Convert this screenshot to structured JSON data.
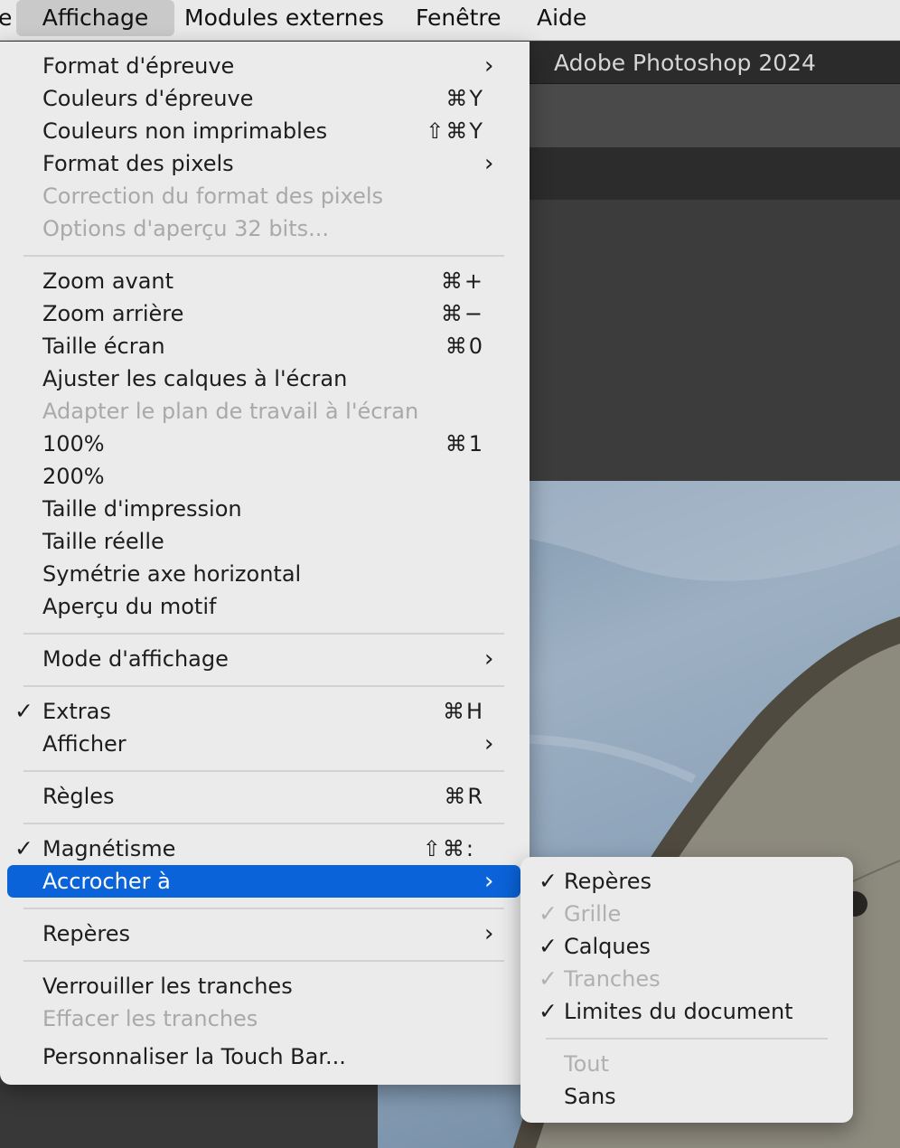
{
  "menubar": {
    "items": [
      {
        "label": "e"
      },
      {
        "label": "Affichage"
      },
      {
        "label": "Modules externes"
      },
      {
        "label": "Fenêtre"
      },
      {
        "label": "Aide"
      }
    ]
  },
  "window": {
    "title": "Adobe Photoshop 2024"
  },
  "menu": {
    "items": [
      {
        "label": "Format d'épreuve",
        "submenu_arrow": "›"
      },
      {
        "label": "Couleurs d'épreuve",
        "shortcut": "⌘Y"
      },
      {
        "label": "Couleurs non imprimables",
        "shortcut": "⇧⌘Y"
      },
      {
        "label": "Format des pixels",
        "submenu_arrow": "›"
      },
      {
        "label": "Correction du format des pixels",
        "disabled": true
      },
      {
        "label": "Options d'aperçu 32 bits...",
        "disabled": true
      },
      {
        "label": "Zoom avant",
        "shortcut": "⌘+"
      },
      {
        "label": "Zoom arrière",
        "shortcut": "⌘−"
      },
      {
        "label": "Taille écran",
        "shortcut": "⌘0"
      },
      {
        "label": "Ajuster les calques à l'écran"
      },
      {
        "label": "Adapter le plan de travail à l'écran",
        "disabled": true
      },
      {
        "label": "100%",
        "shortcut": "⌘1"
      },
      {
        "label": "200%"
      },
      {
        "label": "Taille d'impression"
      },
      {
        "label": "Taille réelle"
      },
      {
        "label": "Symétrie axe horizontal"
      },
      {
        "label": "Aperçu du motif"
      },
      {
        "label": "Mode d'affichage",
        "submenu_arrow": "›"
      },
      {
        "label": "Extras",
        "shortcut": "⌘H",
        "check": "✓"
      },
      {
        "label": "Afficher",
        "submenu_arrow": "›"
      },
      {
        "label": "Règles",
        "shortcut": "⌘R"
      },
      {
        "label": "Magnétisme",
        "shortcut": "⇧⌘:",
        "check": "✓"
      },
      {
        "label": "Accrocher à",
        "submenu_arrow": "›",
        "highlighted": true
      },
      {
        "label": "Repères",
        "submenu_arrow": "›"
      },
      {
        "label": "Verrouiller les tranches"
      },
      {
        "label": "Effacer les tranches",
        "disabled": true
      },
      {
        "label": "Personnaliser la Touch Bar..."
      }
    ]
  },
  "submenu": {
    "items": [
      {
        "label": "Repères",
        "check": "✓"
      },
      {
        "label": "Grille",
        "check": "✓",
        "disabled": true
      },
      {
        "label": "Calques",
        "check": "✓"
      },
      {
        "label": "Tranches",
        "check": "✓",
        "disabled": true
      },
      {
        "label": "Limites du document",
        "check": "✓"
      },
      {
        "label": "Tout",
        "disabled": true
      },
      {
        "label": "Sans"
      }
    ]
  },
  "colors": {
    "highlight": "#0a63d8",
    "menu_bg": "#ebebeb",
    "disabled_text": "#a9a9a9"
  }
}
